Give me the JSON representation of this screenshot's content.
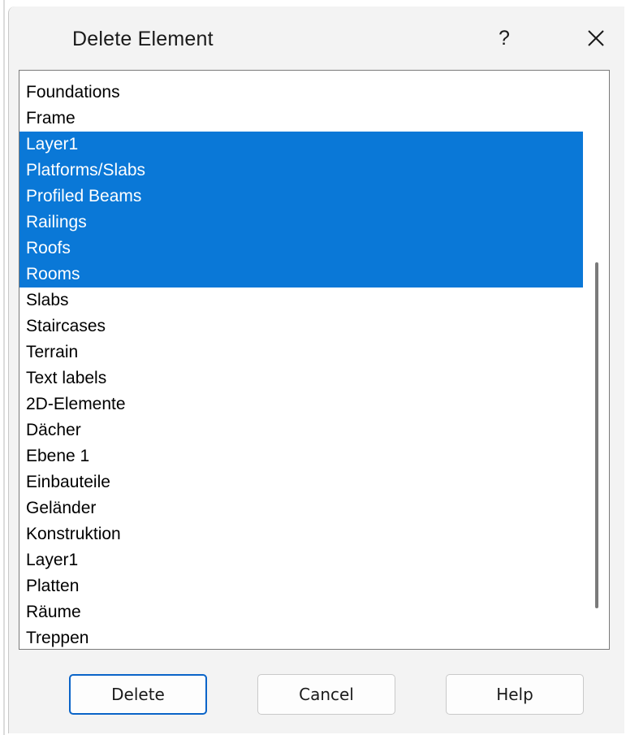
{
  "dialog": {
    "title": "Delete Element",
    "help_glyph": "?",
    "close_icon": "close-icon"
  },
  "list": {
    "items": [
      {
        "label": "Foundations",
        "selected": false
      },
      {
        "label": "Frame",
        "selected": false
      },
      {
        "label": "Layer1",
        "selected": true
      },
      {
        "label": "Platforms/Slabs",
        "selected": true
      },
      {
        "label": "Profiled Beams",
        "selected": true
      },
      {
        "label": "Railings",
        "selected": true
      },
      {
        "label": "Roofs",
        "selected": true
      },
      {
        "label": "Rooms",
        "selected": true
      },
      {
        "label": "Slabs",
        "selected": false
      },
      {
        "label": "Staircases",
        "selected": false
      },
      {
        "label": "Terrain",
        "selected": false
      },
      {
        "label": "Text labels",
        "selected": false
      },
      {
        "label": "2D-Elemente",
        "selected": false
      },
      {
        "label": "Dächer",
        "selected": false
      },
      {
        "label": "Ebene 1",
        "selected": false
      },
      {
        "label": "Einbauteile",
        "selected": false
      },
      {
        "label": "Geländer",
        "selected": false
      },
      {
        "label": "Konstruktion",
        "selected": false
      },
      {
        "label": "Layer1",
        "selected": false
      },
      {
        "label": "Platten",
        "selected": false
      },
      {
        "label": "Räume",
        "selected": false
      },
      {
        "label": "Treppen",
        "selected": false
      }
    ],
    "selection_color": "#0a78d7"
  },
  "buttons": {
    "delete_label": "Delete",
    "cancel_label": "Cancel",
    "help_label": "Help"
  }
}
